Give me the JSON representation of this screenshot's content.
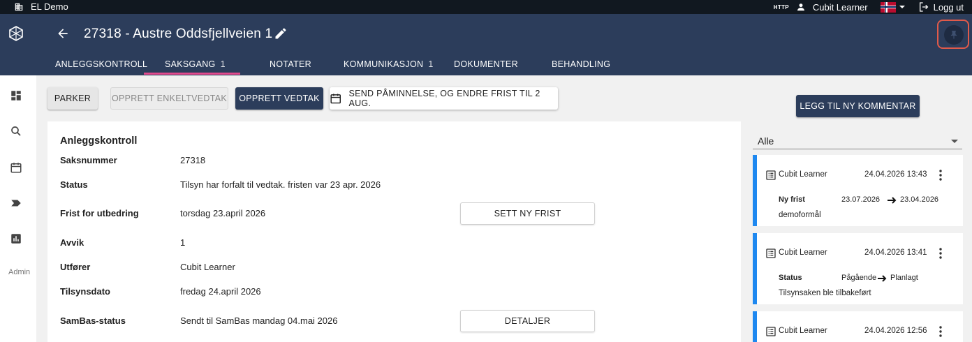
{
  "topbar": {
    "app_name": "EL Demo",
    "http_badge": "HTTP",
    "user_name": "Cubit Learner",
    "logout_label": "Logg ut"
  },
  "header": {
    "title": "27318 - Austre Oddsfjellveien 1"
  },
  "tabs": [
    {
      "label": "ANLEGGSKONTROLL",
      "count": ""
    },
    {
      "label": "SAKSGANG",
      "count": "1"
    },
    {
      "label": "NOTATER",
      "count": ""
    },
    {
      "label": "KOMMUNIKASJON",
      "count": "1"
    },
    {
      "label": "DOKUMENTER",
      "count": ""
    },
    {
      "label": "BEHANDLING",
      "count": ""
    }
  ],
  "sidebar": {
    "admin_label": "Admin"
  },
  "actions": {
    "parker": "PARKER",
    "enkeltvedtak": "OPPRETT ENKELTVEDTAK",
    "vedtak": "OPPRETT VEDTAK",
    "send_reminder": "SEND PÅMINNELSE, OG ENDRE FRIST TIL 2 AUG."
  },
  "card": {
    "title": "Anleggskontroll",
    "rows": [
      {
        "label": "Saksnummer",
        "value": "27318"
      },
      {
        "label": "Status",
        "value": "Tilsyn har forfalt til vedtak. fristen var 23 apr. 2026"
      },
      {
        "label": "Frist for utbedring",
        "value": "torsdag 23.april 2026"
      },
      {
        "label": "Avvik",
        "value": "1"
      },
      {
        "label": "Utfører",
        "value": "Cubit Learner"
      },
      {
        "label": "Tilsynsdato",
        "value": "fredag 24.april 2026"
      },
      {
        "label": "SamBas-status",
        "value": "Sendt til SamBas mandag 04.mai 2026"
      }
    ],
    "set_deadline_button": "SETT NY FRIST",
    "details_button": "DETALJER"
  },
  "comments_panel": {
    "add_button": "LEGG TIL NY KOMMENTAR",
    "filter_value": "Alle",
    "items": [
      {
        "author": "Cubit Learner",
        "time": "24.04.2026 13:43",
        "field": "Ny frist",
        "from": "23.07.2026",
        "to": "23.04.2026",
        "text": "demoformål"
      },
      {
        "author": "Cubit Learner",
        "time": "24.04.2026 13:41",
        "field": "Status",
        "from": "Pågående",
        "to": "Planlagt",
        "text": "Tilsynsaken ble tilbakeført"
      },
      {
        "author": "Cubit Learner",
        "time": "24.04.2026 12:56",
        "field": "",
        "from": "",
        "to": "",
        "text": ""
      }
    ]
  },
  "colors": {
    "header_bg": "#2c3d5b",
    "topbar_bg": "#111820",
    "active_tab_underline": "#e24a8d",
    "comment_accent": "#1e88f0",
    "highlight_ring": "#e05a4a"
  }
}
